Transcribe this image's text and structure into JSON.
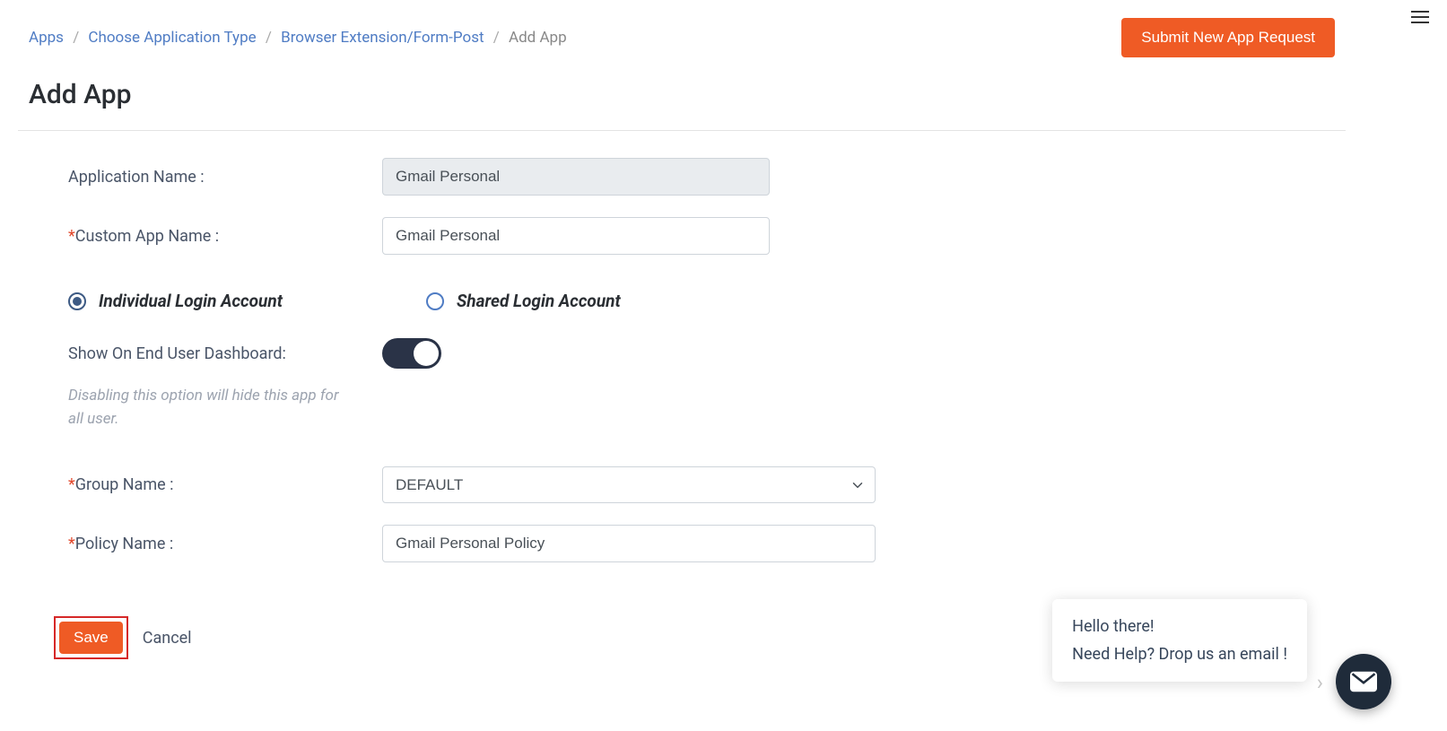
{
  "header": {
    "breadcrumb": {
      "items": [
        {
          "label": "Apps"
        },
        {
          "label": "Choose Application Type"
        },
        {
          "label": "Browser Extension/Form-Post"
        },
        {
          "label": "Add App"
        }
      ]
    },
    "submit_label": "Submit New App Request"
  },
  "page_title": "Add App",
  "form": {
    "application_name": {
      "label": "Application Name :",
      "value": "Gmail Personal"
    },
    "custom_app_name": {
      "label": "Custom App Name :",
      "value": "Gmail Personal"
    },
    "login_type": {
      "individual_label": "Individual Login Account",
      "shared_label": "Shared Login Account"
    },
    "show_dashboard": {
      "label": "Show On End User Dashboard:",
      "help_text": "Disabling this option will hide this app for all user."
    },
    "group_name": {
      "label": "Group Name :",
      "value": "DEFAULT"
    },
    "policy_name": {
      "label": "Policy Name :",
      "value": "Gmail Personal Policy"
    }
  },
  "actions": {
    "save_label": "Save",
    "cancel_label": "Cancel"
  },
  "chat": {
    "greeting": "Hello there!",
    "help_text": "Need Help? Drop us an email !"
  }
}
